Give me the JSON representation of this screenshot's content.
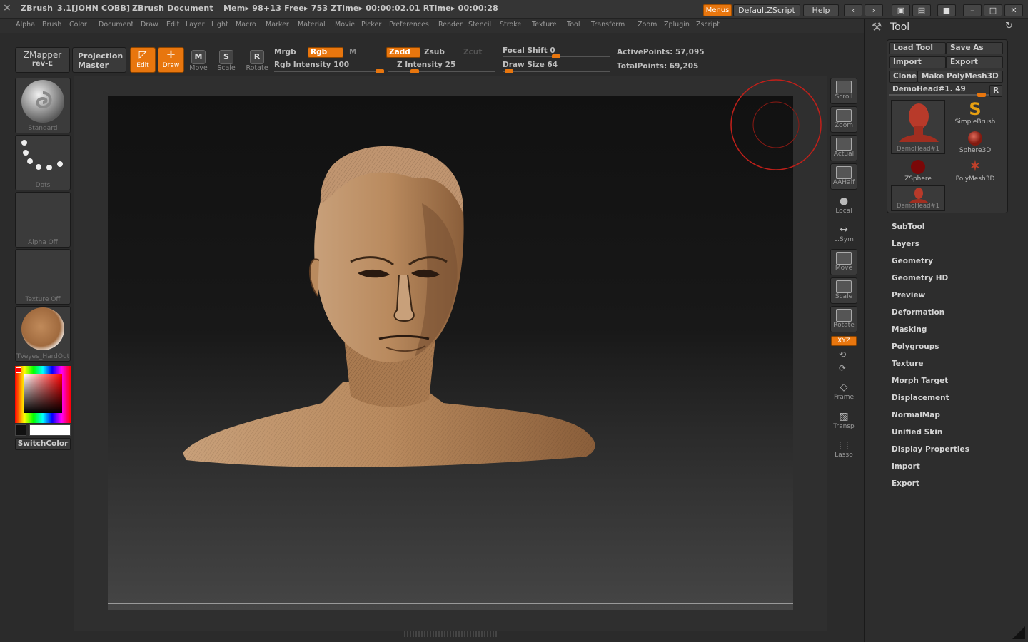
{
  "titlebar": {
    "app": "ZBrush",
    "version": "3.1[JOHN COBB]",
    "doc": "ZBrush Document",
    "stats": "Mem▸ 98+13  Free▸ 753  ZTime▸ 00:00:02.01  RTime▸ 00:00:28",
    "menus_btn": "Menus",
    "script_btn": "DefaultZScript",
    "help_btn": "Help"
  },
  "menubar": [
    "Alpha",
    "Brush",
    "Color",
    "Document",
    "Draw",
    "Edit",
    "Layer",
    "Light",
    "Macro",
    "Marker",
    "Material",
    "Movie",
    "Picker",
    "Preferences",
    "Render",
    "Stencil",
    "Stroke",
    "Texture",
    "Tool",
    "Transform",
    "Zoom",
    "Zplugin",
    "Zscript"
  ],
  "shelf": {
    "zmapper": "ZMapper",
    "zmapper_sub": "rev-E",
    "projection": "Projection",
    "projection_sub": "Master",
    "edit": "Edit",
    "draw": "Draw",
    "move": "Move",
    "scale": "Scale",
    "rotate": "Rotate",
    "mrgb": "Mrgb",
    "rgb": "Rgb",
    "m": "M",
    "rgb_intensity": "Rgb Intensity 100",
    "zadd": "Zadd",
    "zsub": "Zsub",
    "zcut": "Zcut",
    "z_intensity": "Z Intensity 25",
    "focal_shift": "Focal Shift 0",
    "draw_size": "Draw Size 64",
    "active_points": "ActivePoints: 57,095",
    "total_points": "TotalPoints: 69,205",
    "rgb_intensity_value": 100,
    "z_intensity_value": 25,
    "focal_shift_value": 0,
    "draw_size_value": 64
  },
  "left_tray": {
    "brush": "Standard",
    "stroke": "Dots",
    "alpha": "Alpha  Off",
    "texture": "Texture  Off",
    "material": "TVeyes_HardOut",
    "switch_color": "SwitchColor"
  },
  "right_tools": [
    "Scroll",
    "Zoom",
    "Actual",
    "AAHalf",
    "Local",
    "L.Sym",
    "Move",
    "Scale",
    "Rotate",
    "Frame",
    "Transp",
    "Lasso"
  ],
  "xyz": "XYZ",
  "tool_panel": {
    "title": "Tool",
    "load_tool": "Load Tool",
    "save_as": "Save As",
    "import": "Import",
    "export": "Export",
    "clone": "Clone",
    "make_polymesh": "Make PolyMesh3D",
    "current_tool": "DemoHead#1. 49",
    "r_button": "R",
    "thumbs": [
      "DemoHead#1",
      "SimpleBrush",
      "ZSphere",
      "Sphere3D",
      "PolyMesh3D",
      "DemoHead#1"
    ],
    "subpalettes": [
      "SubTool",
      "Layers",
      "Geometry",
      "Geometry HD",
      "Preview",
      "Deformation",
      "Masking",
      "Polygroups",
      "Texture",
      "Morph Target",
      "Displacement",
      "NormalMap",
      "Unified Skin",
      "Display Properties",
      "Import",
      "Export"
    ]
  },
  "colors": {
    "accent": "#e8760e",
    "background": "#2b2b2b",
    "skin": "#b98a5e"
  }
}
